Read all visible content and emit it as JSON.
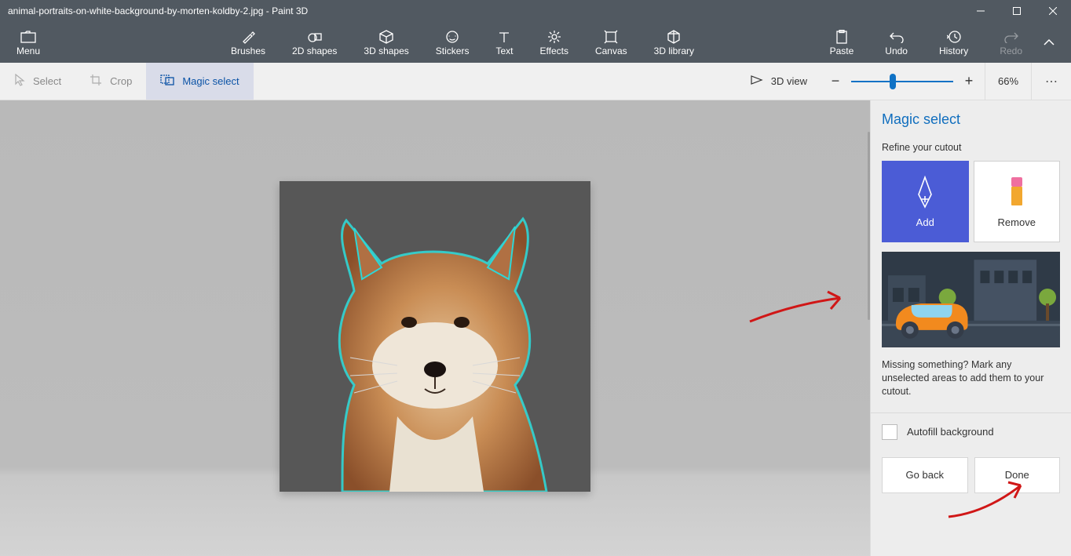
{
  "window": {
    "title": "animal-portraits-on-white-background-by-morten-koldby-2.jpg - Paint 3D"
  },
  "ribbon": {
    "menu": "Menu",
    "brushes": "Brushes",
    "shapes2d": "2D shapes",
    "shapes3d": "3D shapes",
    "stickers": "Stickers",
    "text": "Text",
    "effects": "Effects",
    "canvas": "Canvas",
    "library3d": "3D library",
    "paste": "Paste",
    "undo": "Undo",
    "history": "History",
    "redo": "Redo"
  },
  "subbar": {
    "select": "Select",
    "crop": "Crop",
    "magic_select": "Magic select",
    "view3d": "3D view",
    "zoom": "66%"
  },
  "panel": {
    "title": "Magic select",
    "refine": "Refine your cutout",
    "add": "Add",
    "remove": "Remove",
    "desc": "Missing something? Mark any unselected areas to add them to your cutout.",
    "autofill": "Autofill background",
    "go_back": "Go back",
    "done": "Done"
  }
}
